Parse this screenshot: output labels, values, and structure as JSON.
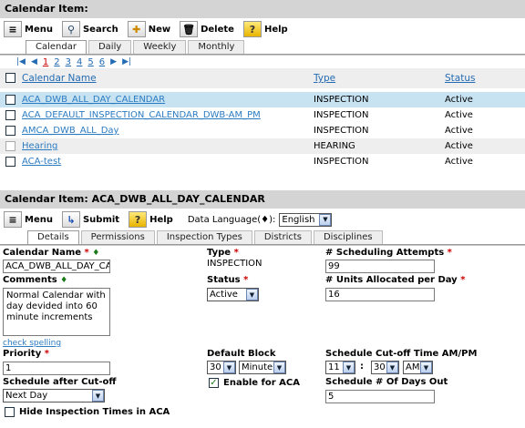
{
  "list": {
    "header_title": "Calendar Item:",
    "toolbar": {
      "menu": "Menu",
      "search": "Search",
      "new": "New",
      "delete": "Delete",
      "help": "Help"
    },
    "tabs": [
      "Calendar",
      "Daily",
      "Weekly",
      "Monthly"
    ],
    "pager": {
      "current": "1",
      "pages": [
        "2",
        "3",
        "4",
        "5",
        "6"
      ]
    },
    "columns": {
      "name": "Calendar Name",
      "type": "Type",
      "status": "Status"
    },
    "rows": [
      {
        "name": "ACA_DWB_ALL_DAY_CALENDAR",
        "type": "INSPECTION",
        "status": "Active"
      },
      {
        "name": "ACA_DEFAULT_INSPECTION_CALENDAR_DWB-AM_PM",
        "type": "INSPECTION",
        "status": "Active"
      },
      {
        "name": "AMCA_DWB_ALL_Day",
        "type": "INSPECTION",
        "status": "Active"
      },
      {
        "name": "Hearing",
        "type": "HEARING",
        "status": "Active"
      },
      {
        "name": "ACA-test",
        "type": "INSPECTION",
        "status": "Active"
      }
    ]
  },
  "detail": {
    "header_title": "Calendar Item: ACA_DWB_ALL_DAY_CALENDAR",
    "toolbar": {
      "menu": "Menu",
      "submit": "Submit",
      "help": "Help",
      "lang_label": "Data Language(♦):",
      "lang_value": "English"
    },
    "tabs": [
      "Details",
      "Permissions",
      "Inspection Types",
      "Districts",
      "Disciplines"
    ],
    "form": {
      "calendar_name_label": "Calendar Name",
      "calendar_name_value": "ACA_DWB_ALL_DAY_CAL",
      "comments_label": "Comments",
      "comments_value": "Normal Calendar with day devided into 60 minute increments",
      "check_spelling": "check spelling",
      "priority_label": "Priority",
      "priority_value": "1",
      "schedule_after_label": "Schedule after Cut-off",
      "schedule_after_value": "Next Day",
      "hide_label": "Hide Inspection Times in ACA",
      "type_label": "Type",
      "type_value": "INSPECTION",
      "status_label": "Status",
      "status_value": "Active",
      "default_block_label": "Default Block",
      "default_block_value": "30",
      "default_block_unit": "Minute",
      "enable_aca_label": "Enable for ACA",
      "sched_attempts_label": "# Scheduling Attempts",
      "sched_attempts_value": "99",
      "units_label": "# Units Allocated per Day",
      "units_value": "16",
      "cutoff_label": "Schedule Cut-off Time  AM/PM",
      "cutoff_hour": "11",
      "cutoff_colon": ":",
      "cutoff_min": "30",
      "cutoff_ampm": "AM",
      "days_out_label": "Schedule # Of Days Out",
      "days_out_value": "5"
    }
  }
}
